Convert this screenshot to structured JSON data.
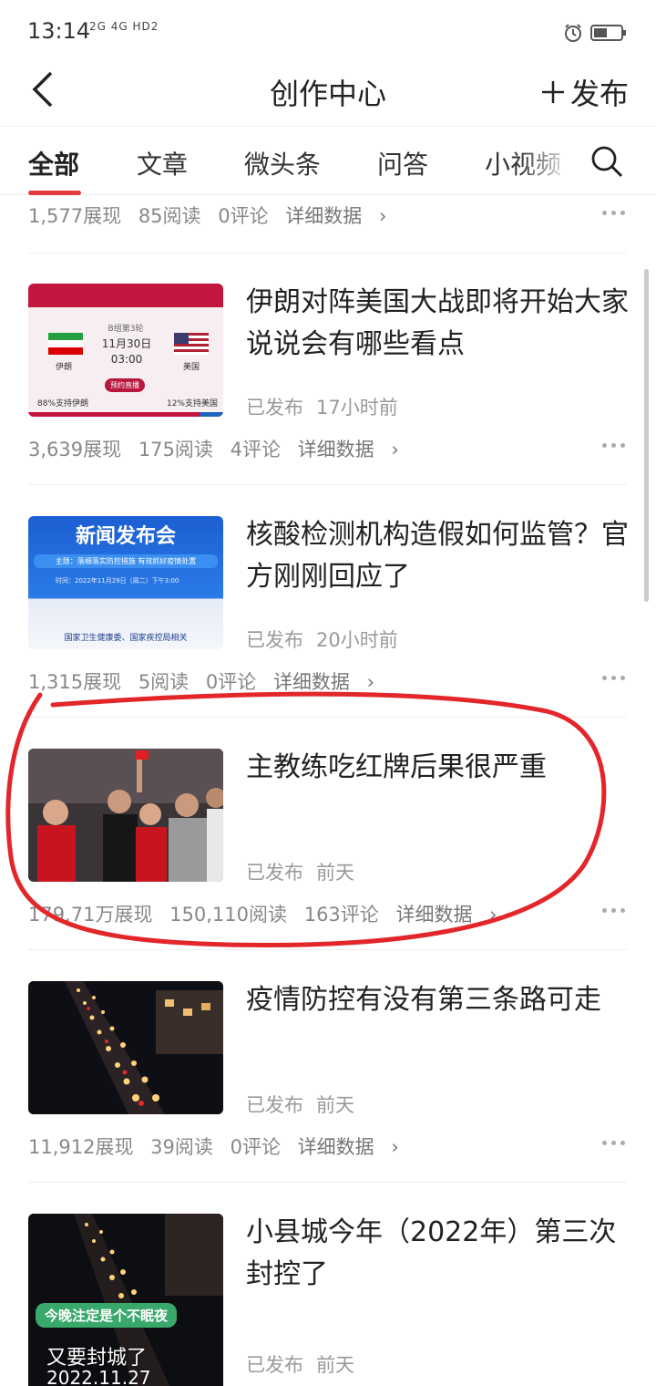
{
  "status_bar": {
    "time": "13:14",
    "network": "2G 4G HD2"
  },
  "header": {
    "title": "创作中心",
    "publish_label": "发布"
  },
  "tabs": [
    {
      "label": "全部",
      "active": true
    },
    {
      "label": "文章",
      "active": false
    },
    {
      "label": "微头条",
      "active": false
    },
    {
      "label": "问答",
      "active": false
    },
    {
      "label": "小视频",
      "active": false
    }
  ],
  "top_stats": {
    "views": "1,577展现",
    "reads": "85阅读",
    "comments": "0评论",
    "detail": "详细数据"
  },
  "cards": [
    {
      "title": "伊朗对阵美国大战即将开始大家说说会有哪些看点",
      "status": "已发布",
      "time": "17小时前",
      "views": "3,639展现",
      "reads": "175阅读",
      "comments": "4评论",
      "detail": "详细数据",
      "thumb": {
        "stage": "B组第3轮",
        "date": "11月30日",
        "kickoff": "03:00",
        "team1": "伊朗",
        "team2": "美国",
        "button": "预约直播",
        "pct1": "88%支持伊朗",
        "pct2": "12%支持美国"
      }
    },
    {
      "title": "核酸检测机构造假如何监管？官方刚刚回应了",
      "status": "已发布",
      "time": "20小时前",
      "views": "1,315展现",
      "reads": "5阅读",
      "comments": "0评论",
      "detail": "详细数据",
      "thumb": {
        "heading": "新闻发布会",
        "subtitle": "主题：落细落实防控措施 有效抓好疫情处置",
        "info": "时间：2022年11月29日（周二）下午3:00",
        "footer": "国家卫生健康委、国家疾控局相关"
      }
    },
    {
      "title": "主教练吃红牌后果很严重",
      "status": "已发布",
      "time": "前天",
      "views": "179.71万展现",
      "reads": "150,110阅读",
      "comments": "163评论",
      "detail": "详细数据",
      "highlighted": true
    },
    {
      "title": "疫情防控有没有第三条路可走",
      "status": "已发布",
      "time": "前天",
      "views": "11,912展现",
      "reads": "39阅读",
      "comments": "0评论",
      "detail": "详细数据"
    },
    {
      "title": "小县城今年（2022年）第三次封控了",
      "status": "已发布",
      "time": "前天",
      "thumb": {
        "caption": "今晚注定是个不眠夜",
        "overlay": "又要封城了",
        "date": "2022.11.27"
      }
    }
  ],
  "colors": {
    "accent": "#e33b3f",
    "annotation": "#e3262a"
  }
}
